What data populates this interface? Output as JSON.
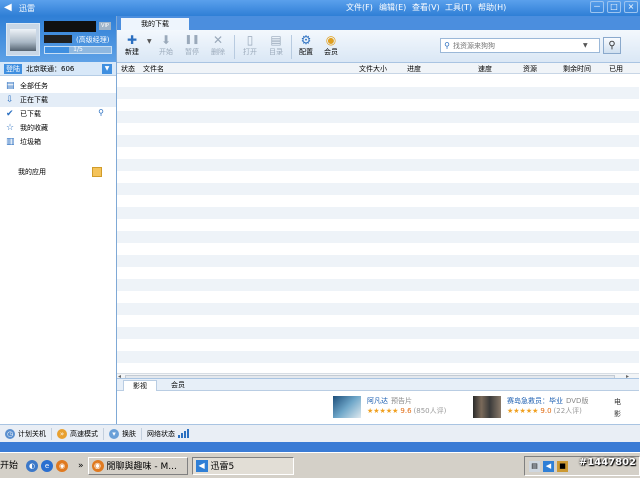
{
  "app": {
    "title": "迅雷",
    "menu": [
      "文件(F)",
      "编辑(E)",
      "查看(V)",
      "工具(T)",
      "帮助(H)"
    ],
    "window_buttons": [
      "－",
      "□",
      "×"
    ]
  },
  "user": {
    "level_text": "(高级经理)",
    "vip_label": "VIP",
    "progress_label": "1/5",
    "progress_fraction": 0.36
  },
  "status": {
    "login_badge": "登陆",
    "server": "北京联通：606"
  },
  "nav": {
    "items": [
      {
        "label": "全部任务",
        "icon": "all-tasks-icon",
        "glyph": "▤"
      },
      {
        "label": "正在下载",
        "icon": "downloading-icon",
        "glyph": "⇩"
      },
      {
        "label": "已下载",
        "icon": "downloaded-icon",
        "glyph": "✔"
      },
      {
        "label": "我的收藏",
        "icon": "favorites-icon",
        "glyph": "☆"
      },
      {
        "label": "垃圾箱",
        "icon": "trash-icon",
        "glyph": "🗑"
      }
    ],
    "apps_label": "我的应用"
  },
  "main": {
    "tab_label": "我的下载",
    "toolbar": [
      {
        "label": "新建",
        "glyph": "✚",
        "enabled": true
      },
      {
        "label": "开始",
        "glyph": "⬇",
        "enabled": false
      },
      {
        "label": "暂停",
        "glyph": "❚❚",
        "enabled": false
      },
      {
        "label": "删除",
        "glyph": "✕",
        "enabled": false
      },
      {
        "label": "打开",
        "glyph": "▯",
        "enabled": false
      },
      {
        "label": "目录",
        "glyph": "▤",
        "enabled": false
      },
      {
        "label": "配置",
        "glyph": "⚙",
        "enabled": true
      },
      {
        "label": "会员",
        "glyph": "◉",
        "enabled": true
      }
    ],
    "search_placeholder": "找资源来狗狗",
    "columns": [
      "状态",
      "文件名",
      "文件大小",
      "进度",
      "速度",
      "资源",
      "剩余时间",
      "已用"
    ]
  },
  "bottom": {
    "tabs": [
      "影视",
      "会员"
    ],
    "movies": [
      {
        "title": "阿凡达",
        "tag": "预告片",
        "stars": "★★★★★",
        "score": "9.6",
        "count": "(850人评)"
      },
      {
        "title": "赛岛急救员：毕业",
        "tag": "DVD版",
        "stars": "★★★★★",
        "score": "9.0",
        "count": "(22人评)"
      }
    ],
    "side_chars": [
      "电",
      "影"
    ]
  },
  "statusbar": {
    "items": [
      "计划关机",
      "高速模式",
      "换肤",
      "网络状态"
    ]
  },
  "taskbar": {
    "start": "开始",
    "tasks": [
      "閒聊與趣味 - M...",
      "迅雷5"
    ],
    "watermark": "#1447802"
  },
  "colors": {
    "accent": "#2f7fd6",
    "titlebar": "#4a90e2",
    "row_alt": "#eef3f8",
    "taskbar": "#d4d0c8"
  }
}
